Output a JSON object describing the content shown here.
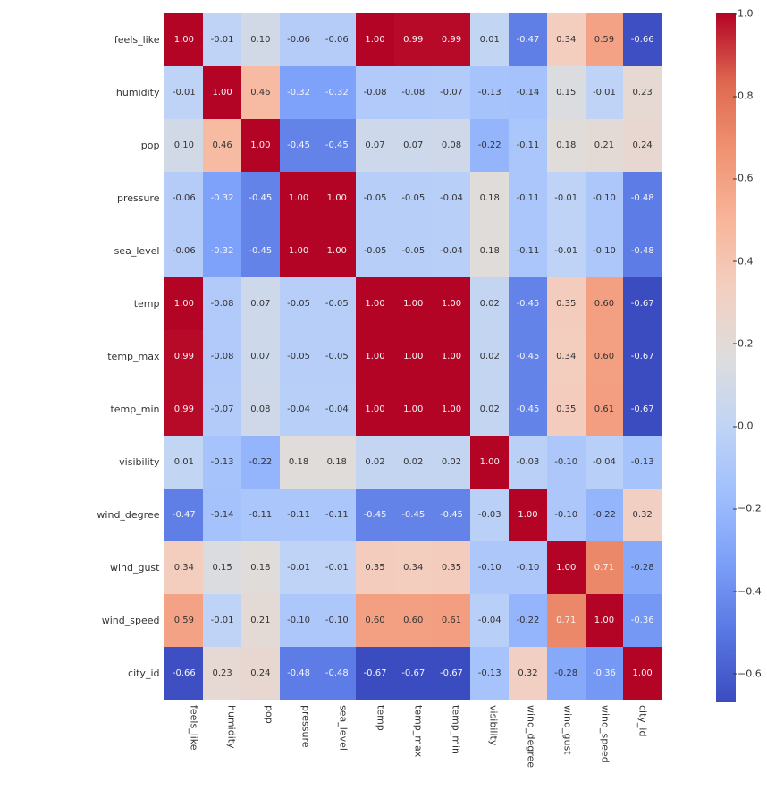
{
  "chart_data": {
    "type": "heatmap",
    "labels": [
      "feels_like",
      "humidity",
      "pop",
      "pressure",
      "sea_level",
      "temp",
      "temp_max",
      "temp_min",
      "visibility",
      "wind_degree",
      "wind_gust",
      "wind_speed",
      "city_id"
    ],
    "matrix": [
      [
        1.0,
        -0.01,
        0.1,
        -0.06,
        -0.06,
        1.0,
        0.99,
        0.99,
        0.01,
        -0.47,
        0.34,
        0.59,
        -0.66
      ],
      [
        -0.01,
        1.0,
        0.46,
        -0.32,
        -0.32,
        -0.08,
        -0.08,
        -0.07,
        -0.13,
        -0.14,
        0.15,
        -0.01,
        0.23
      ],
      [
        0.1,
        0.46,
        1.0,
        -0.45,
        -0.45,
        0.07,
        0.07,
        0.08,
        -0.22,
        -0.11,
        0.18,
        0.21,
        0.24
      ],
      [
        -0.06,
        -0.32,
        -0.45,
        1.0,
        1.0,
        -0.05,
        -0.05,
        -0.04,
        0.18,
        -0.11,
        -0.01,
        -0.1,
        -0.48
      ],
      [
        -0.06,
        -0.32,
        -0.45,
        1.0,
        1.0,
        -0.05,
        -0.05,
        -0.04,
        0.18,
        -0.11,
        -0.01,
        -0.1,
        -0.48
      ],
      [
        1.0,
        -0.08,
        0.07,
        -0.05,
        -0.05,
        1.0,
        1.0,
        1.0,
        0.02,
        -0.45,
        0.35,
        0.6,
        -0.67
      ],
      [
        0.99,
        -0.08,
        0.07,
        -0.05,
        -0.05,
        1.0,
        1.0,
        1.0,
        0.02,
        -0.45,
        0.34,
        0.6,
        -0.67
      ],
      [
        0.99,
        -0.07,
        0.08,
        -0.04,
        -0.04,
        1.0,
        1.0,
        1.0,
        0.02,
        -0.45,
        0.35,
        0.61,
        -0.67
      ],
      [
        0.01,
        -0.13,
        -0.22,
        0.18,
        0.18,
        0.02,
        0.02,
        0.02,
        1.0,
        -0.03,
        -0.1,
        -0.04,
        -0.13
      ],
      [
        -0.47,
        -0.14,
        -0.11,
        -0.11,
        -0.11,
        -0.45,
        -0.45,
        -0.45,
        -0.03,
        1.0,
        -0.1,
        -0.22,
        0.32
      ],
      [
        0.34,
        0.15,
        0.18,
        -0.01,
        -0.01,
        0.35,
        0.34,
        0.35,
        -0.1,
        -0.1,
        1.0,
        0.71,
        -0.28
      ],
      [
        0.59,
        -0.01,
        0.21,
        -0.1,
        -0.1,
        0.6,
        0.6,
        0.61,
        -0.04,
        -0.22,
        0.71,
        1.0,
        -0.36
      ],
      [
        -0.66,
        0.23,
        0.24,
        -0.48,
        -0.48,
        -0.67,
        -0.67,
        -0.67,
        -0.13,
        0.32,
        -0.28,
        -0.36,
        1.0
      ]
    ],
    "vmin": -0.67,
    "vmax": 1.0,
    "colorbar_ticks": [
      -0.6,
      -0.4,
      -0.2,
      0.0,
      0.2,
      0.4,
      0.6,
      0.8,
      1.0
    ],
    "cmap_note": "seaborn coolwarm-like diverging"
  }
}
